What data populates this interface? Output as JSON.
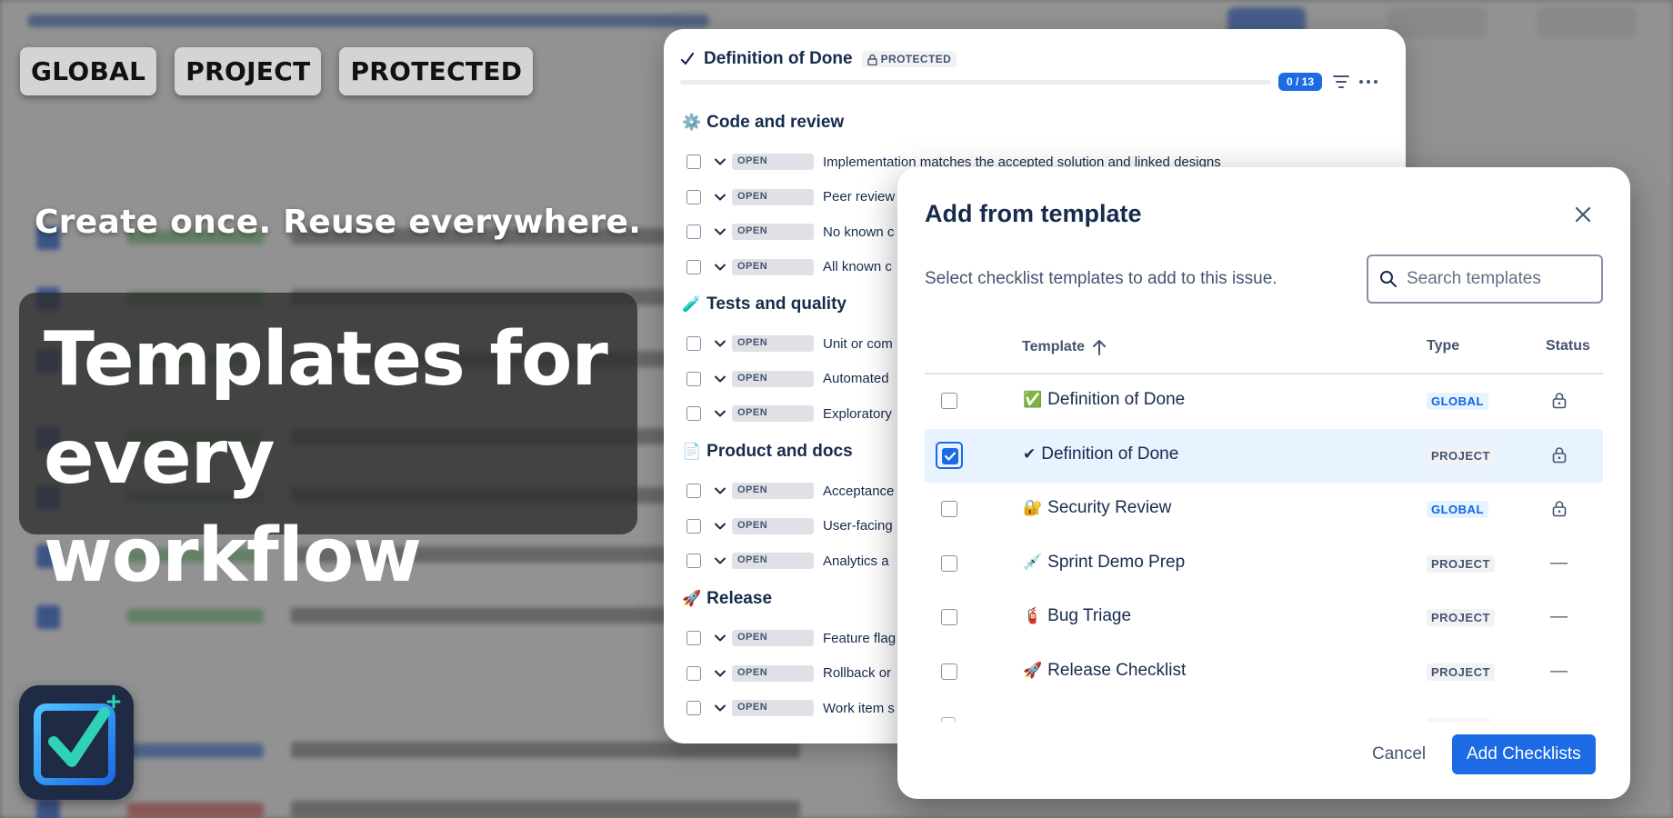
{
  "hero": {
    "tags": [
      "GLOBAL",
      "PROJECT",
      "PROTECTED"
    ],
    "tagline": "Create once. Reuse everywhere.",
    "title_line1": "Templates for",
    "title_line2": "every workflow"
  },
  "checklist_card": {
    "title": "Definition of Done",
    "title_icon": "checkmark-icon",
    "protected_label": "PROTECTED",
    "progress_label": "0 / 13",
    "progress_fraction": 0,
    "groups": [
      {
        "icon": "⚙️",
        "title": "Code and review",
        "items": [
          {
            "status": "OPEN",
            "text": "Implementation matches the accepted solution and linked designs"
          },
          {
            "status": "OPEN",
            "text": "Peer review"
          },
          {
            "status": "OPEN",
            "text": "No known c"
          },
          {
            "status": "OPEN",
            "text": "All known c"
          }
        ]
      },
      {
        "icon": "🧪",
        "title": "Tests and quality",
        "items": [
          {
            "status": "OPEN",
            "text": "Unit or com"
          },
          {
            "status": "OPEN",
            "text": "Automated"
          },
          {
            "status": "OPEN",
            "text": "Exploratory"
          }
        ]
      },
      {
        "icon": "📄",
        "title": "Product and docs",
        "items": [
          {
            "status": "OPEN",
            "text": "Acceptance"
          },
          {
            "status": "OPEN",
            "text": "User-facing"
          },
          {
            "status": "OPEN",
            "text": "Analytics a"
          }
        ]
      },
      {
        "icon": "🚀",
        "title": "Release",
        "items": [
          {
            "status": "OPEN",
            "text": "Feature flag"
          },
          {
            "status": "OPEN",
            "text": "Rollback or"
          },
          {
            "status": "OPEN",
            "text": "Work item s"
          }
        ]
      }
    ]
  },
  "modal": {
    "title": "Add from template",
    "description": "Select checklist templates to add to this issue.",
    "search": {
      "placeholder": "Search templates",
      "value": ""
    },
    "columns": {
      "template": "Template",
      "type": "Type",
      "status": "Status"
    },
    "sort": "ascending",
    "rows": [
      {
        "icon": "✅",
        "name": "Definition of Done",
        "type": "GLOBAL",
        "status": "locked",
        "selected": false
      },
      {
        "icon": "✔",
        "name": "Definition of Done",
        "type": "PROJECT",
        "status": "locked",
        "selected": true
      },
      {
        "icon": "🔐",
        "name": "Security Review",
        "type": "GLOBAL",
        "status": "locked",
        "selected": false
      },
      {
        "icon": "💉",
        "name": "Sprint Demo Prep",
        "type": "PROJECT",
        "status": "—",
        "selected": false
      },
      {
        "icon": "🧯",
        "name": "Bug Triage",
        "type": "PROJECT",
        "status": "—",
        "selected": false
      },
      {
        "icon": "🚀",
        "name": "Release Checklist",
        "type": "PROJECT",
        "status": "—",
        "selected": false
      }
    ],
    "cancel_label": "Cancel",
    "add_label": "Add Checklists"
  },
  "colors": {
    "accent": "#1d6ae5",
    "global_badge": "#0c66e4",
    "logo_tile": "#1f2a44"
  }
}
